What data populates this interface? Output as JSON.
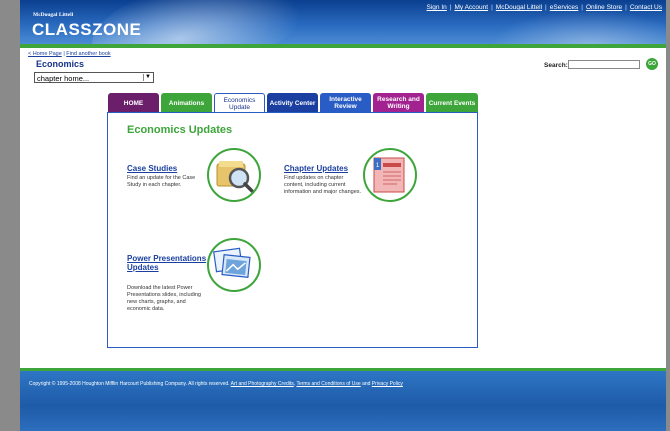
{
  "header": {
    "publisher": "McDougal Littell",
    "logo": "CLASSZONE",
    "links": [
      "Sign In",
      "My Account",
      "McDougal Littell",
      "eServices",
      "Online Store",
      "Contact Us"
    ]
  },
  "breadcrumb": {
    "home": "< Home Page",
    "find": "Find another book"
  },
  "subject": "Economics",
  "chapter_select": {
    "value": "chapter home..."
  },
  "search": {
    "label": "Search:",
    "go": "GO"
  },
  "tabs": [
    {
      "label": "HOME",
      "color": "#6b1f6b"
    },
    {
      "label": "Animations",
      "color": "#3da53a"
    },
    {
      "label": "Economics Update",
      "color": "#ffffff"
    },
    {
      "label": "Activity Center",
      "color": "#1a3fa0"
    },
    {
      "label": "Interactive Review",
      "color": "#2a5cc5"
    },
    {
      "label": "Research and Writing",
      "color": "#a2238f"
    },
    {
      "label": "Current Events",
      "color": "#3da53a"
    }
  ],
  "content": {
    "title": "Economics Updates",
    "case_studies": {
      "title": "Case Studies",
      "desc": "Find an update for the Case Study in each chapter."
    },
    "chapter_updates": {
      "title": "Chapter Updates",
      "desc": "Find updates on chapter content, including current information and major changes."
    },
    "power": {
      "title": "Power Presentations Updates",
      "desc": "Download the latest Power Presentations slides, including new charts, graphs, and economic data."
    }
  },
  "footer": {
    "copyright": "Copyright © 1995-2008 Houghton Mifflin Harcourt Publishing Company. All rights reserved.",
    "credits": "Art and Photography Credits",
    "terms": "Terms and Conditions of Use",
    "and": "and",
    "privacy": "Privacy Policy"
  }
}
